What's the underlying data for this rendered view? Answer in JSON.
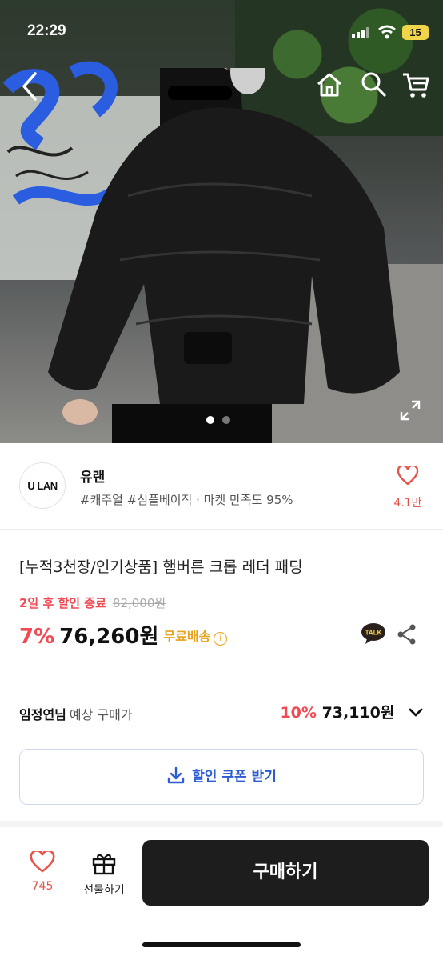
{
  "status_bar": {
    "time": "22:29",
    "battery": "15"
  },
  "seller": {
    "logo_text": "U LAN",
    "name": "유랜",
    "tags": "#캐주얼 #심플베이직 · 마켓 만족도 95%",
    "favorite_count": "4.1만"
  },
  "product": {
    "title": "[누적3천장/인기상품] 햄버른 크롭 레더 패딩",
    "promo_label": "2일 후 할인 종료",
    "original_price": "82,000원",
    "discount_rate": "7%",
    "price": "76,260원",
    "shipping": "무료배송"
  },
  "expected_price": {
    "user_name": "임정연님",
    "label": "예상 구매가",
    "discount_rate": "10%",
    "price": "73,110원"
  },
  "coupon_button": "할인 쿠폰 받기",
  "bottom_bar": {
    "like_count": "745",
    "gift_label": "선물하기",
    "buy_label": "구매하기"
  },
  "carousel": {
    "pages": 2,
    "active": 1
  },
  "colors": {
    "accent_red": "#f04a53",
    "coupon_blue": "#2d5bd1",
    "shipping_orange": "#e9a21b"
  },
  "icons": [
    "back-icon",
    "home-icon",
    "search-icon",
    "cart-icon",
    "expand-icon",
    "heart-icon",
    "talk-icon",
    "share-icon",
    "info-icon",
    "chevron-down-icon",
    "download-icon",
    "gift-icon"
  ]
}
